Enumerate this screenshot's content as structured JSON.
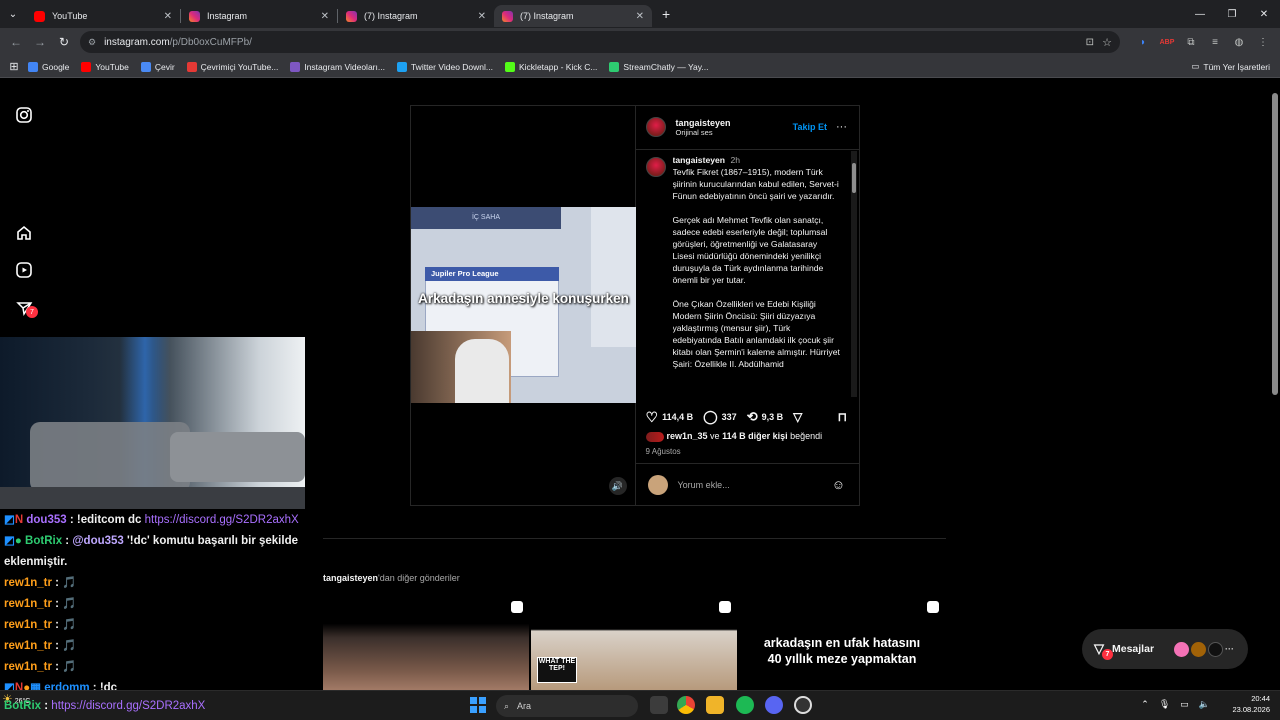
{
  "browser": {
    "tabs": [
      {
        "title": "YouTube",
        "icon": "youtube-icon",
        "color": "#ff0000"
      },
      {
        "title": "Instagram",
        "icon": "instagram-icon",
        "color": "#e1306c"
      },
      {
        "title": "(7) Instagram",
        "icon": "instagram-icon",
        "color": "#e1306c"
      },
      {
        "title": "(7) Instagram",
        "icon": "instagram-icon",
        "color": "#e1306c"
      }
    ],
    "url_host": "instagram.com",
    "url_path": "/p/Db0oxCuMFPb/",
    "bookmarks": [
      {
        "label": "Google",
        "color": "#4285f4"
      },
      {
        "label": "YouTube",
        "color": "#ff0000"
      },
      {
        "label": "Çevir",
        "color": "#4a8af4"
      },
      {
        "label": "Çevrimiçi YouTube...",
        "color": "#e53935"
      },
      {
        "label": "Instagram Videoları...",
        "color": "#7e57c2"
      },
      {
        "label": "Twitter Video Downl...",
        "color": "#1da1f2"
      },
      {
        "label": "Kickletapp - Kick C...",
        "color": "#53fc18"
      },
      {
        "label": "StreamChatly — Yay...",
        "color": "#2ecc71"
      }
    ],
    "all_bookmarks": "Tüm Yer İşaretleri"
  },
  "post": {
    "username": "tangaisteyen",
    "audio": "Orijinal ses",
    "follow": "Takip Et",
    "caption_user": "tangaisteyen",
    "caption_time": "2h",
    "caption_paragraphs": [
      "Tevfik Fikret (1867–1915), modern Türk şiirinin kurucularından kabul edilen, Servet-i Fünun edebiyatının öncü şairi ve yazarıdır.",
      "Gerçek adı Mehmet Tevfik olan sanatçı, sadece edebi eserleriyle değil; toplumsal görüşleri, öğretmenliği ve Galatasaray Lisesi müdürlüğü dönemindeki yenilikçi duruşuyla da Türk aydınlanma tarihinde önemli bir yer tutar.",
      "Öne Çıkan Özellikleri ve Edebi Kişiliği Modern Şiirin Öncüsü: Şiiri düzyazıya yaklaştırmış (mensur şiir), Türk edebiyatında Batılı anlamdaki ilk çocuk şiir kitabı olan Şermin'i kaleme almıştır. Hürriyet Şairi: Özellikle II. Abdülhamid"
    ],
    "video_overlay": "Arkadaşın annesiyle konuşurken",
    "video_league": "Jupiler Pro League",
    "video_header": "İÇ SAHA",
    "likes_count": "114,4 B",
    "comments_count": "337",
    "shares_count": "9,3 B",
    "liked_by_user": "rew1n_35",
    "liked_by_join": "ve",
    "liked_by_others": "114 B diğer kişi",
    "liked_by_suffix": "beğendi",
    "date": "9 Ağustos",
    "comment_placeholder": "Yorum ekle..."
  },
  "more_posts": {
    "user": "tangaisteyen",
    "suffix": "'dan diğer gönderiler",
    "third_caption": "arkadaşın en ufak hatasını 40 yıllık meze yapmaktan"
  },
  "messages": {
    "label": "Mesajlar",
    "badge": "7"
  },
  "nav_badge": "7",
  "chat": [
    {
      "user": "dou353",
      "sep": " : ",
      "text": "!editcom dc",
      "link": "https://discord.gg/S2DR2axhX",
      "color": "purple"
    },
    {
      "user": "BotRix",
      "sep": " : ",
      "mention": "@dou353",
      "text": " '!dc' komutu başarılı bir şekilde",
      "color": "green"
    },
    {
      "text": "eklenmiştir."
    },
    {
      "user": "rew1n_tr",
      "sep": " : ",
      "text": "🎵",
      "color": "orange"
    },
    {
      "user": "rew1n_tr",
      "sep": " : ",
      "text": "🎵",
      "color": "orange"
    },
    {
      "user": "rew1n_tr",
      "sep": " : ",
      "text": "🎵",
      "color": "orange"
    },
    {
      "user": "rew1n_tr",
      "sep": " : ",
      "text": "🎵",
      "color": "orange"
    },
    {
      "user": "rew1n_tr",
      "sep": " : ",
      "text": "🎵",
      "color": "orange"
    },
    {
      "user": "erdomm",
      "sep": " : ",
      "text": "!dc",
      "color": "blue"
    },
    {
      "user": "BotRix",
      "sep": " : ",
      "link": "https://discord.gg/S2DR2axhX",
      "color": "green"
    }
  ],
  "taskbar": {
    "search": "Ara",
    "weather": "26°C",
    "time": "20:44",
    "date": "23.08.2026"
  }
}
